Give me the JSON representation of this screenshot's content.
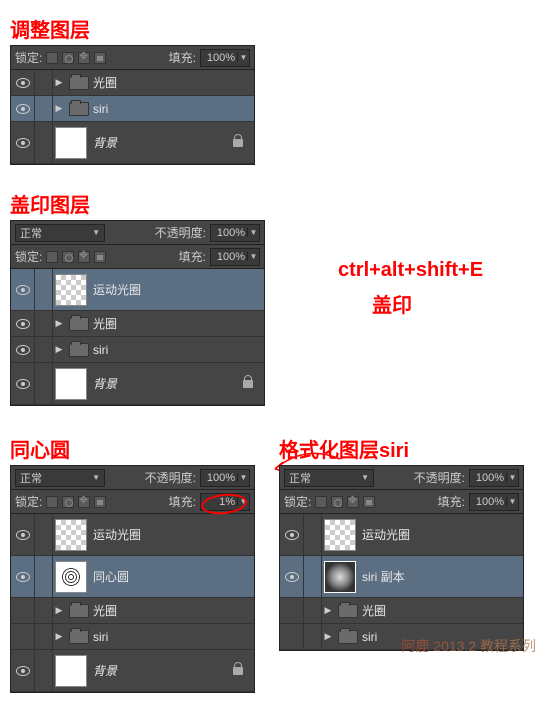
{
  "panel1": {
    "title": "调整图层",
    "lock_label": "锁定:",
    "fill_label": "填充:",
    "fill_value": "100%",
    "layers": [
      {
        "name": "光圈"
      },
      {
        "name": "siri"
      },
      {
        "name": "背景"
      }
    ]
  },
  "panel2": {
    "title": "盖印图层",
    "blend_mode": "正常",
    "opacity_label": "不透明度:",
    "opacity_value": "100%",
    "lock_label": "锁定:",
    "fill_label": "填充:",
    "fill_value": "100%",
    "layers": [
      {
        "name": "运动光圈"
      },
      {
        "name": "光圈"
      },
      {
        "name": "siri"
      },
      {
        "name": "背景"
      }
    ],
    "annotation1": "ctrl+alt+shift+E",
    "annotation2": "盖印"
  },
  "panel3": {
    "title": "同心圆",
    "blend_mode": "正常",
    "opacity_label": "不透明度:",
    "opacity_value": "100%",
    "lock_label": "锁定:",
    "fill_label": "填充:",
    "fill_value": "1%",
    "layers": [
      {
        "name": "运动光圈"
      },
      {
        "name": "同心圆"
      },
      {
        "name": "光圈"
      },
      {
        "name": "siri"
      },
      {
        "name": "背景"
      }
    ]
  },
  "panel4": {
    "title": "格式化图层siri",
    "blend_mode": "正常",
    "opacity_label": "不透明度:",
    "opacity_value": "100%",
    "lock_label": "锁定:",
    "fill_label": "填充:",
    "fill_value": "100%",
    "layers": [
      {
        "name": "运动光圈"
      },
      {
        "name": "siri 副本"
      },
      {
        "name": "光圈"
      },
      {
        "name": "siri"
      }
    ]
  },
  "watermark": "阿鹿 2013.2 教程系列"
}
